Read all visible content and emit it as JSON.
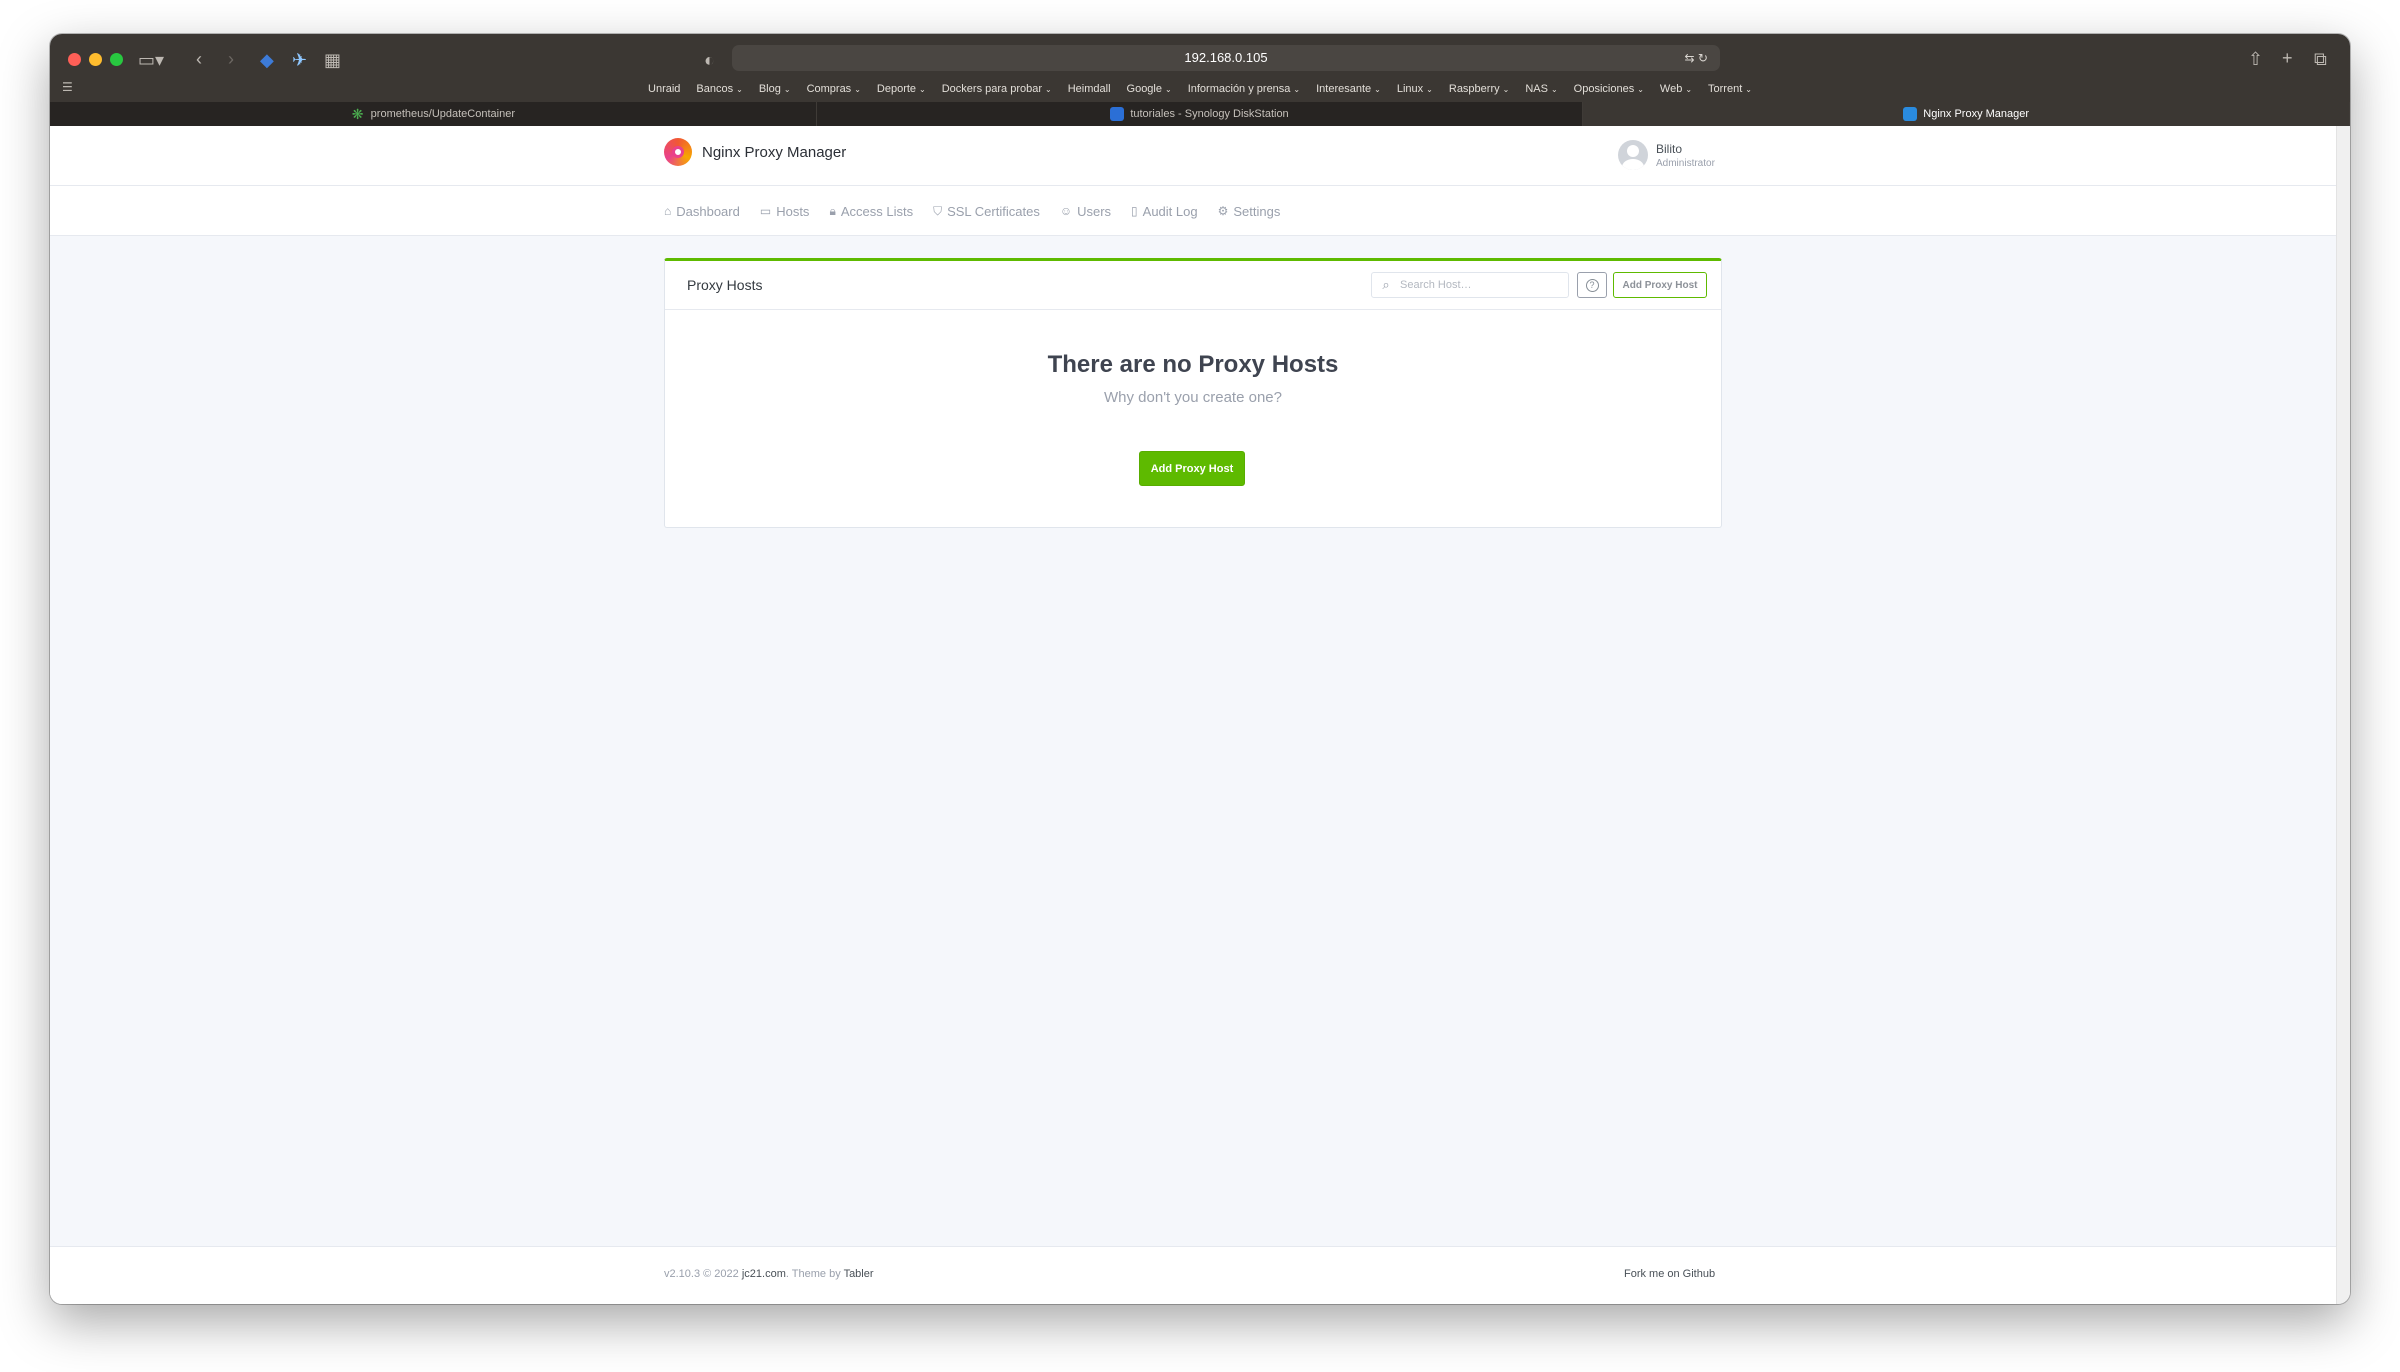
{
  "browser": {
    "url": "192.168.0.105",
    "bookmarks": [
      {
        "label": "Unraid",
        "has_menu": false
      },
      {
        "label": "Bancos",
        "has_menu": true
      },
      {
        "label": "Blog",
        "has_menu": true
      },
      {
        "label": "Compras",
        "has_menu": true
      },
      {
        "label": "Deporte",
        "has_menu": true
      },
      {
        "label": "Dockers para probar",
        "has_menu": true
      },
      {
        "label": "Heimdall",
        "has_menu": false
      },
      {
        "label": "Google",
        "has_menu": true
      },
      {
        "label": "Información y prensa",
        "has_menu": true
      },
      {
        "label": "Interesante",
        "has_menu": true
      },
      {
        "label": "Linux",
        "has_menu": true
      },
      {
        "label": "Raspberry",
        "has_menu": true
      },
      {
        "label": "NAS",
        "has_menu": true
      },
      {
        "label": "Oposiciones",
        "has_menu": true
      },
      {
        "label": "Web",
        "has_menu": true
      },
      {
        "label": "Torrent",
        "has_menu": true
      }
    ],
    "tabs": [
      {
        "label": "prometheus/UpdateContainer",
        "icon": "prometheus-favicon",
        "active": false
      },
      {
        "label": "tutoriales - Synology DiskStation",
        "icon": "synology-favicon",
        "active": false
      },
      {
        "label": "Nginx Proxy Manager",
        "icon": "npm-favicon",
        "active": true
      }
    ]
  },
  "app": {
    "brand": "Nginx Proxy Manager",
    "user": {
      "name": "Bilito",
      "role": "Administrator"
    },
    "nav": [
      {
        "label": "Dashboard",
        "icon": "home-icon",
        "glyph": "⌂"
      },
      {
        "label": "Hosts",
        "icon": "monitor-icon",
        "glyph": "▭"
      },
      {
        "label": "Access Lists",
        "icon": "lock-icon",
        "glyph": "🔒︎"
      },
      {
        "label": "SSL Certificates",
        "icon": "shield-icon",
        "glyph": "⛉"
      },
      {
        "label": "Users",
        "icon": "users-icon",
        "glyph": "☺"
      },
      {
        "label": "Audit Log",
        "icon": "book-icon",
        "glyph": "▯"
      },
      {
        "label": "Settings",
        "icon": "gear-icon",
        "glyph": "⚙"
      }
    ]
  },
  "card": {
    "title": "Proxy Hosts",
    "search_placeholder": "Search Host…",
    "add_button": "Add Proxy Host",
    "empty_title": "There are no Proxy Hosts",
    "empty_subtitle": "Why don't you create one?",
    "empty_button": "Add Proxy Host"
  },
  "footer": {
    "version_prefix": "v2.10.3 © 2022",
    "site": "jc21.com",
    "theme_prefix": ". Theme by",
    "theme": "Tabler",
    "github": "Fork me on Github"
  },
  "colors": {
    "accent": "#5eba00",
    "toolbar": "#3b3733",
    "page_bg": "#f5f7fb"
  }
}
